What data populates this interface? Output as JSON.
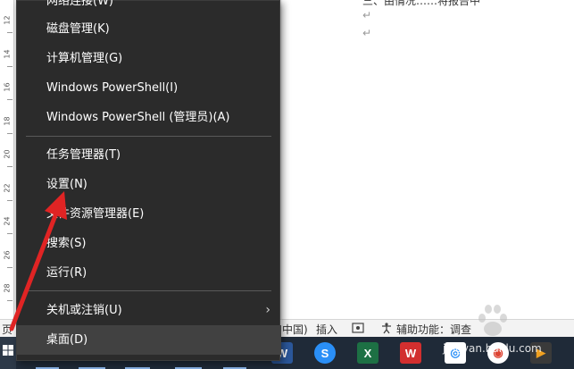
{
  "document": {
    "top_text": "三、由情况……将报告中",
    "ruler_numbers": [
      "12",
      "14",
      "16",
      "18",
      "20",
      "22",
      "24",
      "26",
      "28"
    ]
  },
  "context_menu": {
    "items": [
      {
        "label": "网络连接(W)",
        "has_submenu": false
      },
      {
        "label": "磁盘管理(K)",
        "has_submenu": false
      },
      {
        "label": "计算机管理(G)",
        "has_submenu": false
      },
      {
        "label": "Windows PowerShell(I)",
        "has_submenu": false
      },
      {
        "label": "Windows PowerShell (管理员)(A)",
        "has_submenu": false
      },
      {
        "label": "任务管理器(T)",
        "has_submenu": false
      },
      {
        "label": "设置(N)",
        "has_submenu": false
      },
      {
        "label": "文件资源管理器(E)",
        "has_submenu": false
      },
      {
        "label": "搜索(S)",
        "has_submenu": false
      },
      {
        "label": "运行(R)",
        "has_submenu": false
      },
      {
        "label": "关机或注销(U)",
        "has_submenu": true
      },
      {
        "label": "桌面(D)",
        "has_submenu": false
      }
    ],
    "submenu_glyph": "›"
  },
  "statusbar": {
    "page_label": "页",
    "lang": "中国)",
    "insert": "插入",
    "accessibility": "辅助功能：调查"
  },
  "taskbar": {
    "watermark": "jingyan.baidu.com",
    "icons": [
      {
        "name": "word-icon",
        "glyph": "W",
        "color": "#2b579a"
      },
      {
        "name": "sogou-icon",
        "glyph": "S",
        "color": "#2a8ff7"
      },
      {
        "name": "excel-icon",
        "glyph": "X",
        "color": "#1d7044"
      },
      {
        "name": "wps-icon",
        "glyph": "W",
        "color": "#d22f2f"
      },
      {
        "name": "baidu-netdisk-icon",
        "glyph": "◎",
        "color": "#ffffff"
      },
      {
        "name": "chrome-icon",
        "glyph": "◉",
        "color": "#ffffff"
      },
      {
        "name": "media-player-icon",
        "glyph": "▶",
        "color": "#f0a020"
      }
    ]
  },
  "colors": {
    "menu_bg": "#2b2b2b",
    "menu_highlight": "#414141",
    "arrow": "#e02424",
    "taskbar_bg": "#1f2a38"
  }
}
